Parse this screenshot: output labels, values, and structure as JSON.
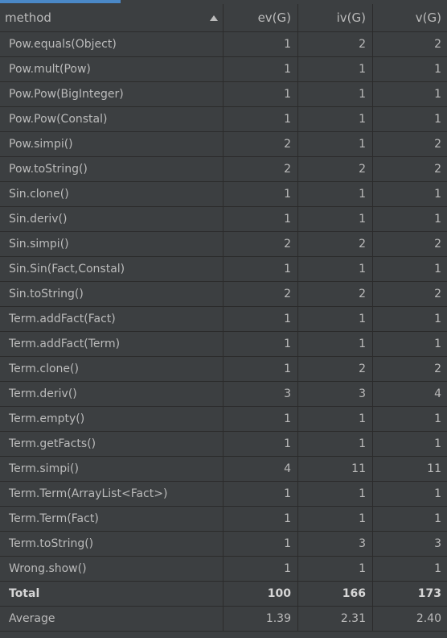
{
  "columns": {
    "method": "method",
    "ev": "ev(G)",
    "iv": "iv(G)",
    "v": "v(G)"
  },
  "rows": [
    {
      "method": "Pow.equals(Object)",
      "ev": "1",
      "iv": "2",
      "v": "2"
    },
    {
      "method": "Pow.mult(Pow)",
      "ev": "1",
      "iv": "1",
      "v": "1"
    },
    {
      "method": "Pow.Pow(BigInteger)",
      "ev": "1",
      "iv": "1",
      "v": "1"
    },
    {
      "method": "Pow.Pow(Constal)",
      "ev": "1",
      "iv": "1",
      "v": "1"
    },
    {
      "method": "Pow.simpi()",
      "ev": "2",
      "iv": "1",
      "v": "2"
    },
    {
      "method": "Pow.toString()",
      "ev": "2",
      "iv": "2",
      "v": "2"
    },
    {
      "method": "Sin.clone()",
      "ev": "1",
      "iv": "1",
      "v": "1"
    },
    {
      "method": "Sin.deriv()",
      "ev": "1",
      "iv": "1",
      "v": "1"
    },
    {
      "method": "Sin.simpi()",
      "ev": "2",
      "iv": "2",
      "v": "2"
    },
    {
      "method": "Sin.Sin(Fact,Constal)",
      "ev": "1",
      "iv": "1",
      "v": "1"
    },
    {
      "method": "Sin.toString()",
      "ev": "2",
      "iv": "2",
      "v": "2"
    },
    {
      "method": "Term.addFact(Fact)",
      "ev": "1",
      "iv": "1",
      "v": "1"
    },
    {
      "method": "Term.addFact(Term)",
      "ev": "1",
      "iv": "1",
      "v": "1"
    },
    {
      "method": "Term.clone()",
      "ev": "1",
      "iv": "2",
      "v": "2"
    },
    {
      "method": "Term.deriv()",
      "ev": "3",
      "iv": "3",
      "v": "4"
    },
    {
      "method": "Term.empty()",
      "ev": "1",
      "iv": "1",
      "v": "1"
    },
    {
      "method": "Term.getFacts()",
      "ev": "1",
      "iv": "1",
      "v": "1"
    },
    {
      "method": "Term.simpi()",
      "ev": "4",
      "iv": "11",
      "v": "11"
    },
    {
      "method": "Term.Term(ArrayList<Fact>)",
      "ev": "1",
      "iv": "1",
      "v": "1"
    },
    {
      "method": "Term.Term(Fact)",
      "ev": "1",
      "iv": "1",
      "v": "1"
    },
    {
      "method": "Term.toString()",
      "ev": "1",
      "iv": "3",
      "v": "3"
    },
    {
      "method": "Wrong.show()",
      "ev": "1",
      "iv": "1",
      "v": "1"
    }
  ],
  "total": {
    "label": "Total",
    "ev": "100",
    "iv": "166",
    "v": "173"
  },
  "average": {
    "label": "Average",
    "ev": "1.39",
    "iv": "2.31",
    "v": "2.40"
  },
  "icons": {
    "sort": "sort-ascending-icon"
  },
  "colors": {
    "background": "#3c3f41",
    "grid": "#2b2b2b",
    "text": "#bbbbbb",
    "tab_indicator": "#4a88c7"
  }
}
